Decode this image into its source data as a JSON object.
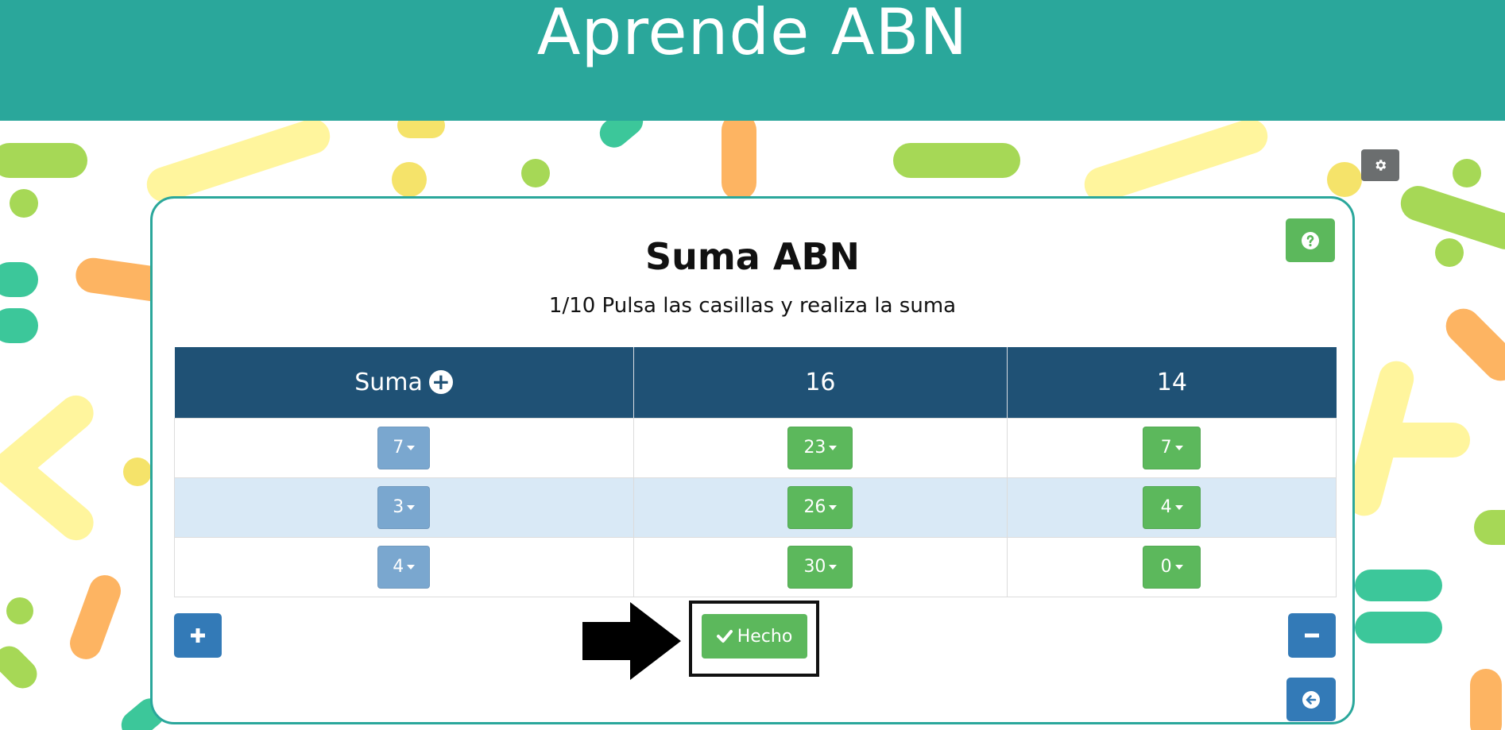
{
  "app": {
    "title": "Aprende ABN"
  },
  "exercise": {
    "title": "Suma ABN",
    "instruction": "1/10 Pulsa las casillas y realiza la suma"
  },
  "table": {
    "headers": [
      "Suma",
      "16",
      "14"
    ],
    "rows": [
      [
        "7",
        "23",
        "7"
      ],
      [
        "3",
        "26",
        "4"
      ],
      [
        "4",
        "30",
        "0"
      ]
    ]
  },
  "actions": {
    "done_label": "Hecho"
  },
  "icons": {
    "settings": "gear-icon",
    "help": "question-icon",
    "add": "plus-icon",
    "remove": "minus-icon",
    "back": "arrow-left-circle-icon",
    "done": "check-icon",
    "header_add": "plus-circle-icon"
  },
  "colors": {
    "header": "#2aa79b",
    "table_header": "#1f5175",
    "success": "#5cb85c",
    "primary": "#337ab7",
    "muted_blue": "#7aa7cf",
    "row_highlight": "#d9e9f6"
  }
}
